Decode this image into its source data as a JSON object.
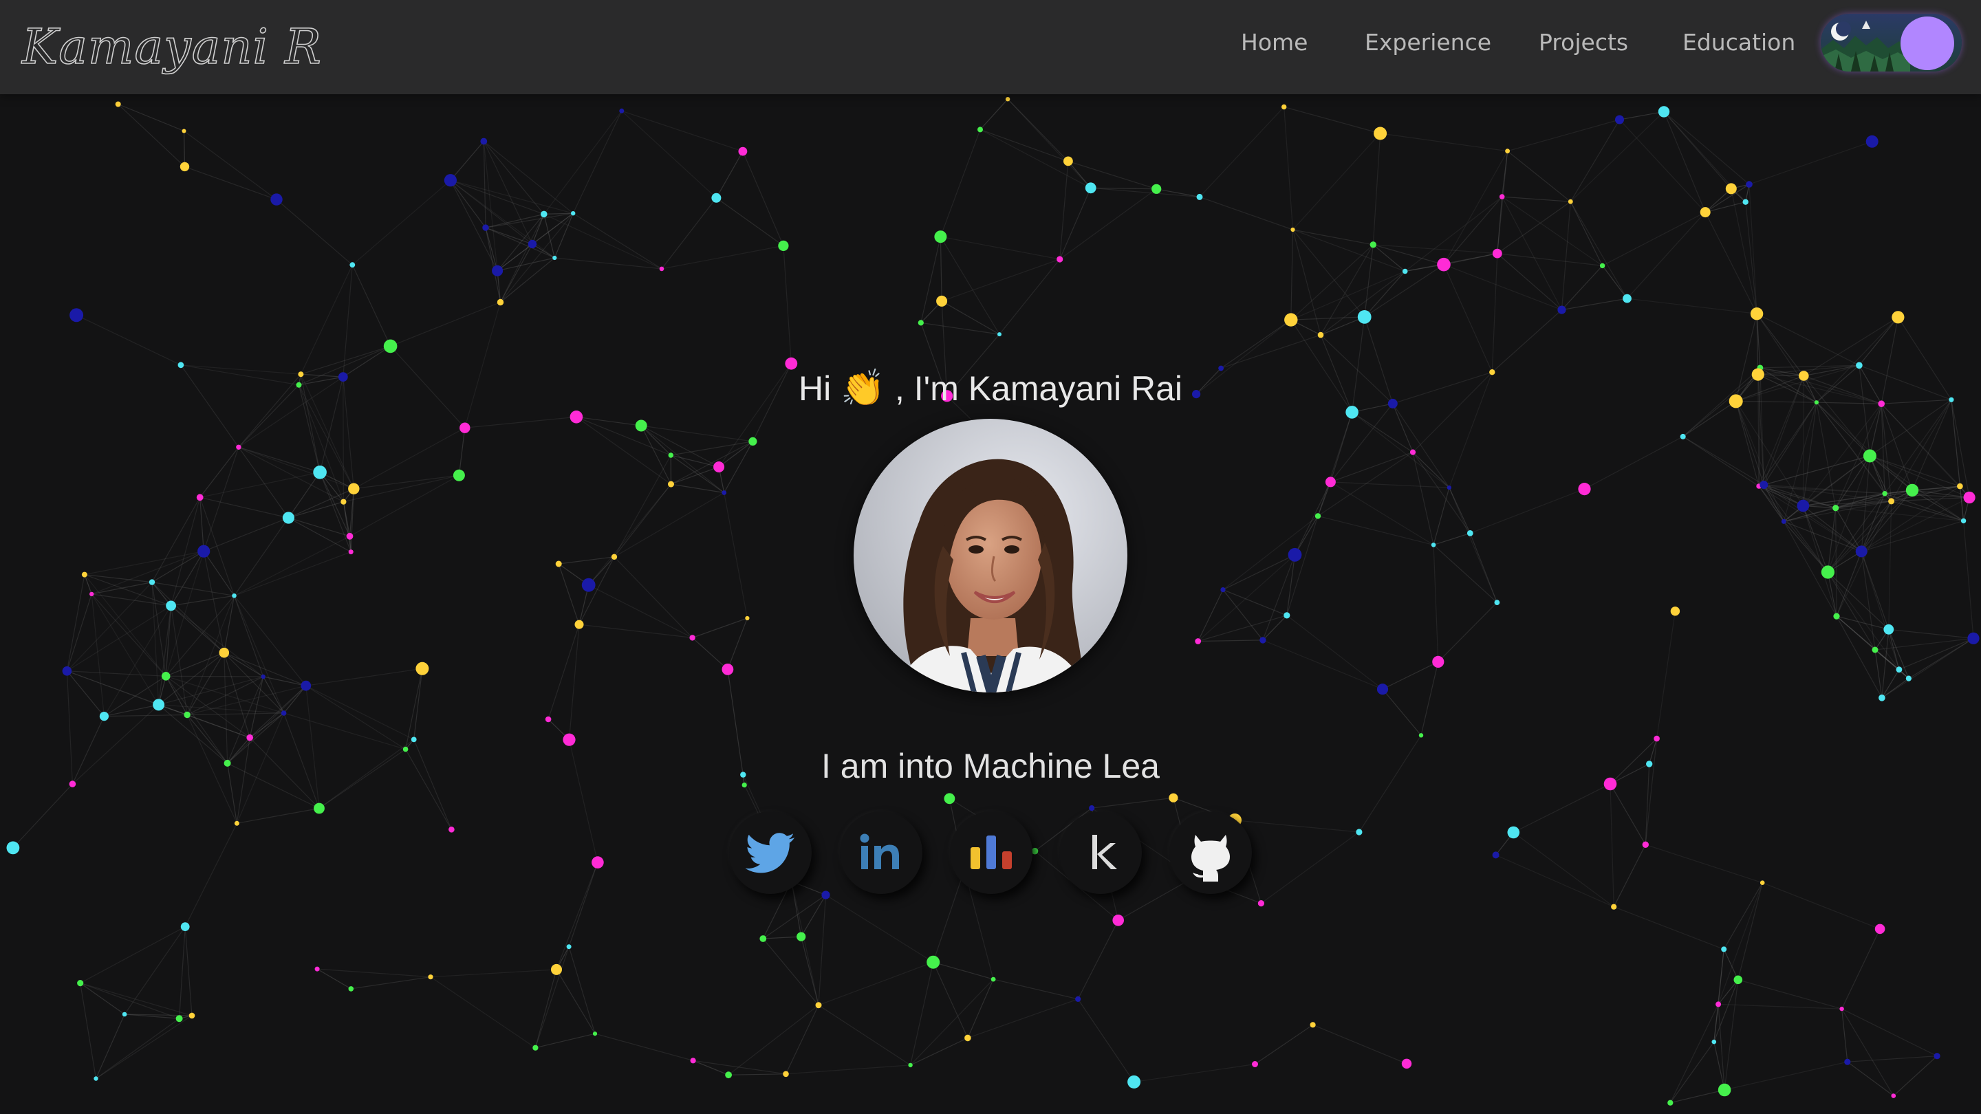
{
  "header": {
    "logo_text": "Kamayani Rai",
    "nav": [
      {
        "label": "Home"
      },
      {
        "label": "Experience"
      },
      {
        "label": "Projects"
      },
      {
        "label": "Education"
      }
    ],
    "theme_toggle": {
      "state": "dark",
      "icon": "moon-night-scene-icon",
      "knob_color": "#b186ff"
    }
  },
  "hero": {
    "greeting_hi": "Hi",
    "greeting_emoji": "👏",
    "greeting_rest": ", I'm Kamayani Rai",
    "tagline": "I am into Machine Lea",
    "profile_photo": "profile-photo"
  },
  "socials": [
    {
      "name": "twitter",
      "icon": "twitter-icon",
      "color": "#5ea5e6"
    },
    {
      "name": "linkedin",
      "icon": "linkedin-icon",
      "color": "#3d7fb6"
    },
    {
      "name": "analytics",
      "icon": "bar-chart-icon",
      "colors": [
        "#f2c12e",
        "#4f7ad6",
        "#c5402d"
      ]
    },
    {
      "name": "kaggle",
      "icon": "kaggle-icon",
      "color": "#dcdcdc"
    },
    {
      "name": "github",
      "icon": "github-icon",
      "color": "#f0f0f0"
    }
  ],
  "theme": {
    "background": "#131314",
    "navbar": "#2a2a2b",
    "particle_colors": [
      "#ff2bd6",
      "#45f04c",
      "#4fe6f2",
      "#ffd23a",
      "#1a1aa8"
    ]
  }
}
